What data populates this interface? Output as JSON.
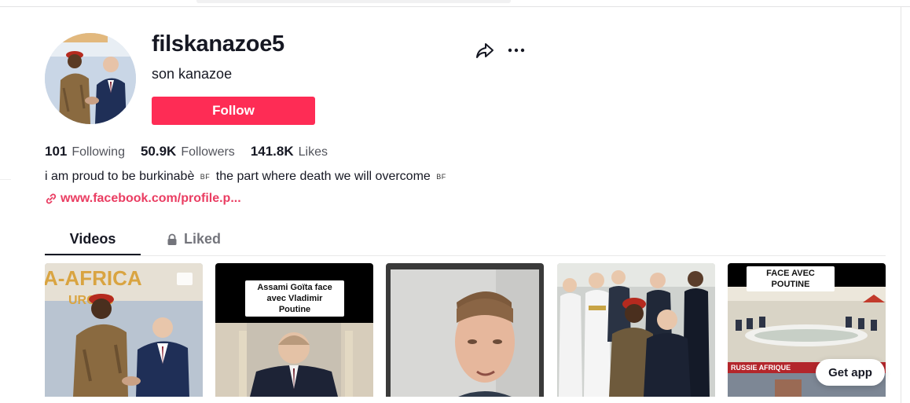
{
  "profile": {
    "username": "filskanazoe5",
    "nickname": "son kanazoe",
    "follow_label": "Follow",
    "bio_prefix": "i am proud to be burkinabè",
    "bio_flag_1": "BF",
    "bio_middle": "the part where death we will overcome",
    "bio_flag_2": "BF",
    "link": "www.facebook.com/profile.p..."
  },
  "stats": [
    {
      "value": "101",
      "label": "Following"
    },
    {
      "value": "50.9K",
      "label": "Followers"
    },
    {
      "value": "141.8K",
      "label": "Likes"
    }
  ],
  "tabs": {
    "videos": "Videos",
    "liked": "Liked"
  },
  "videos": [
    {
      "overlay_text": "A-AFRICA",
      "overlay_text_2": "URG 20"
    },
    {
      "caption": "Assami Goïta face avec Vladimir Poutine"
    },
    {
      "caption": ""
    },
    {
      "caption": ""
    },
    {
      "caption": "FACE AVEC POUTINE",
      "banner": "RUSSIE AFRIQUE"
    }
  ],
  "get_app_label": "Get app",
  "colors": {
    "accent": "#fe2c55",
    "link": "#ea3d62",
    "text": "#161823"
  },
  "icons": [
    "share-icon",
    "more-icon",
    "link-icon",
    "lock-icon"
  ]
}
